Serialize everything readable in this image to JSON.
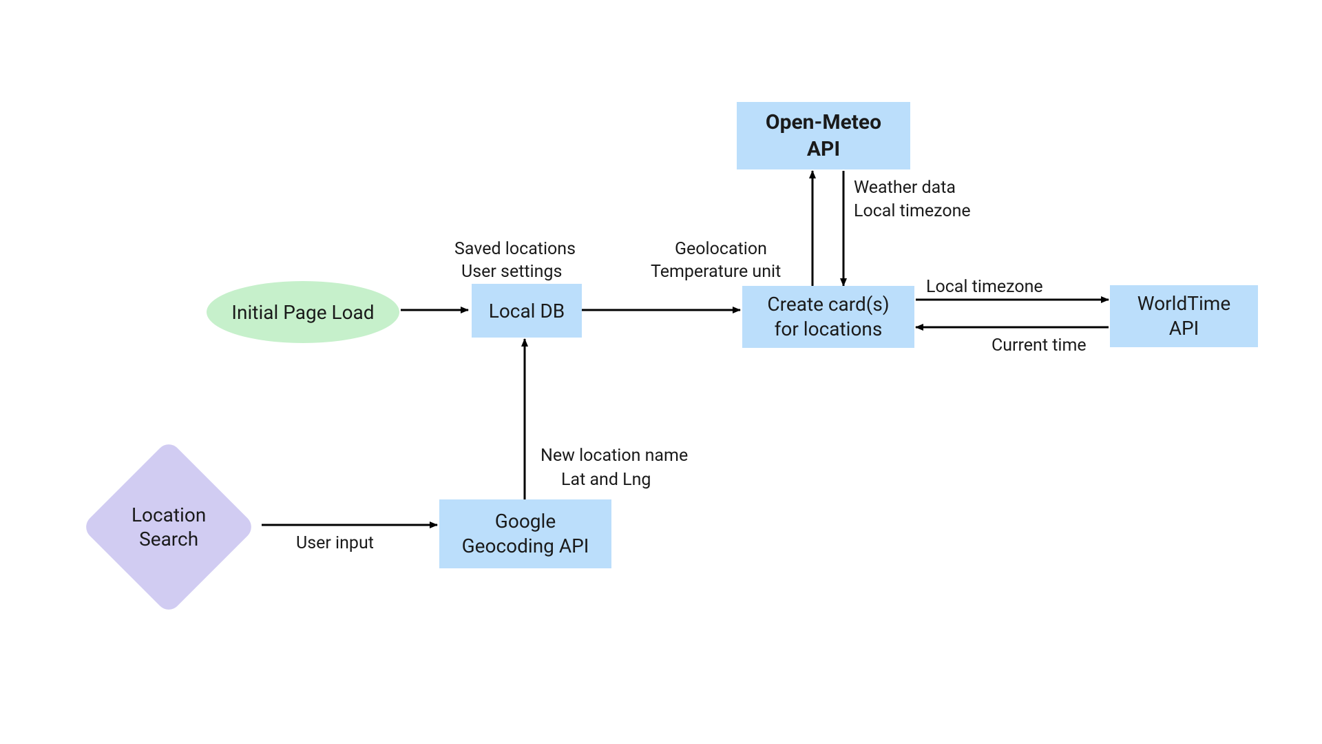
{
  "nodes": {
    "initial_page_load": "Initial Page Load",
    "local_db": "Local DB",
    "open_meteo_api_line1": "Open-Meteo",
    "open_meteo_api_line2": "API",
    "create_cards_line1": "Create card(s)",
    "create_cards_line2": "for locations",
    "worldtime_api_line1": "WorldTime",
    "worldtime_api_line2": "API",
    "location_search_line1": "Location",
    "location_search_line2": "Search",
    "google_geocoding_line1": "Google",
    "google_geocoding_line2": "Geocoding API"
  },
  "edges": {
    "saved_locations": "Saved locations",
    "user_settings": "User settings",
    "geolocation": "Geolocation",
    "temperature_unit": "Temperature unit",
    "weather_data": "Weather data",
    "local_timezone_a": "Local timezone",
    "local_timezone_b": "Local timezone",
    "current_time": "Current time",
    "user_input": "User input",
    "new_location_name": "New location name",
    "lat_and_lng": "Lat and Lng"
  },
  "colors": {
    "rect": "#bbdefb",
    "ellipse": "#c6f0cb",
    "diamond": "#d1ccf2",
    "arrow": "#000000"
  }
}
